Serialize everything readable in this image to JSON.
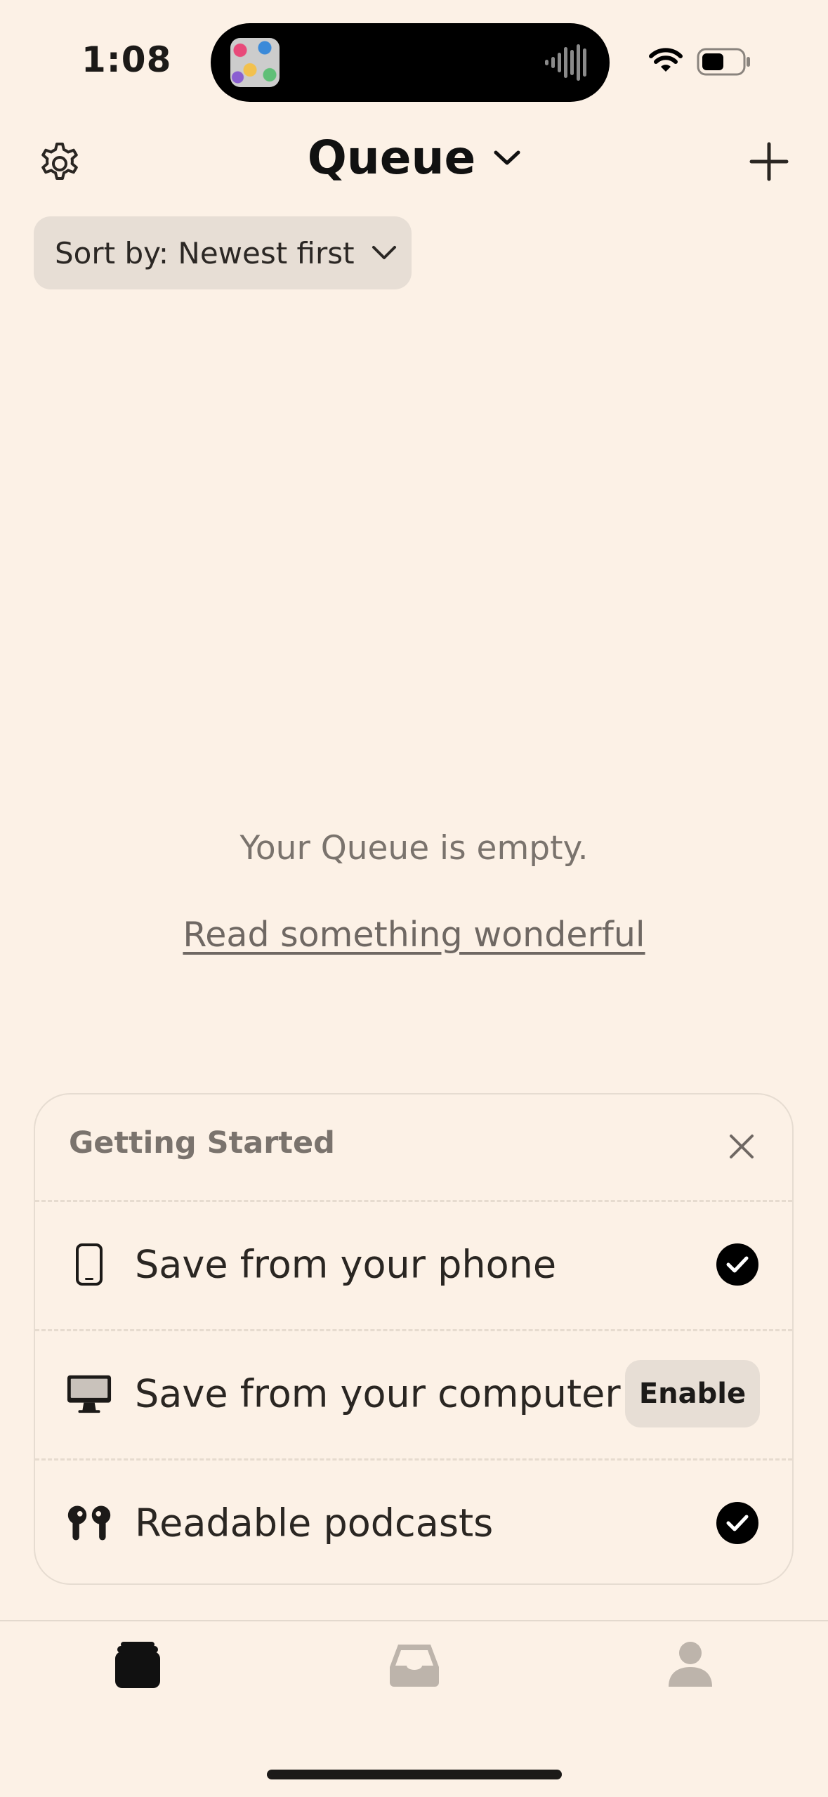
{
  "status_bar": {
    "time": "1:08"
  },
  "header": {
    "title": "Queue"
  },
  "sort": {
    "label": "Sort by: Newest first"
  },
  "empty_state": {
    "message": "Your Queue is empty.",
    "link": "Read something wonderful"
  },
  "getting_started": {
    "title": "Getting Started",
    "items": [
      {
        "label": "Save from your phone",
        "icon": "phone-icon",
        "status": "done"
      },
      {
        "label": "Save from your computer",
        "icon": "computer-icon",
        "action_label": "Enable"
      },
      {
        "label": "Readable podcasts",
        "icon": "airpods-icon",
        "status": "done"
      }
    ]
  },
  "tabs": [
    {
      "name": "queue",
      "icon": "stack-icon",
      "active": true
    },
    {
      "name": "inbox",
      "icon": "inbox-icon",
      "active": false
    },
    {
      "name": "profile",
      "icon": "person-icon",
      "active": false
    }
  ],
  "colors": {
    "background": "#FCF1E6",
    "pill": "#E7DED5",
    "text_muted": "#7a736d",
    "icon_inactive": "#BDB4AB"
  }
}
